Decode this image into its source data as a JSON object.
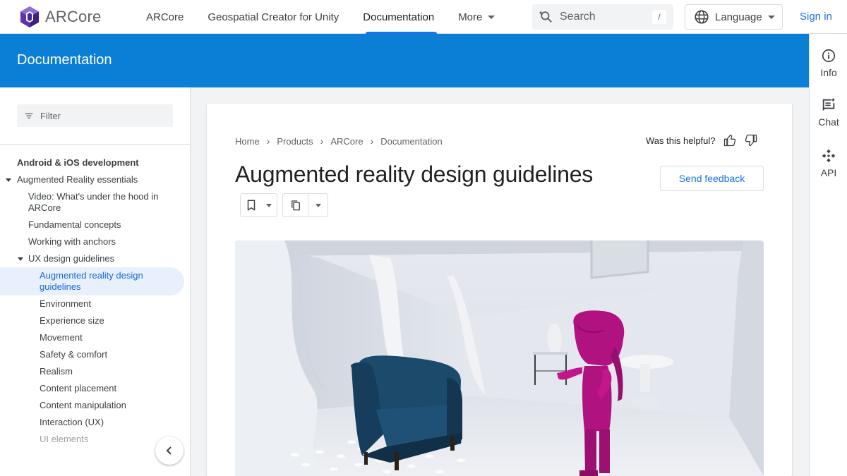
{
  "header": {
    "brand": "ARCore",
    "nav": [
      "ARCore",
      "Geospatial Creator for Unity",
      "Documentation",
      "More"
    ],
    "search_placeholder": "Search",
    "search_shortcut": "/",
    "language_label": "Language",
    "signin_label": "Sign in"
  },
  "band": {
    "title": "Documentation"
  },
  "rail": {
    "items": [
      "Info",
      "Chat",
      "API"
    ]
  },
  "sidebar": {
    "filter_placeholder": "Filter",
    "section_heading": "Android & iOS development",
    "items": [
      "Augmented Reality essentials",
      "Video: What's under the hood in",
      "ARCore",
      "Fundamental concepts",
      "Working with anchors",
      "UX design guidelines",
      "Augmented reality design",
      "guidelines",
      "Environment",
      "Experience size",
      "Movement",
      "Safety & comfort",
      "Realism",
      "Content placement",
      "Content manipulation",
      "Interaction (UX)",
      "UI elements"
    ]
  },
  "main": {
    "breadcrumbs": [
      "Home",
      "Products",
      "ARCore",
      "Documentation"
    ],
    "helpful_prompt": "Was this helpful?",
    "title": "Augmented reality design guidelines",
    "feedback_label": "Send feedback"
  },
  "colors": {
    "brand_blue": "#0a7fd5",
    "link_blue": "#1a73e8",
    "active_bg": "#e8f0fe",
    "figure_magenta": "#b0127f",
    "chair_navy": "#163d5c"
  }
}
